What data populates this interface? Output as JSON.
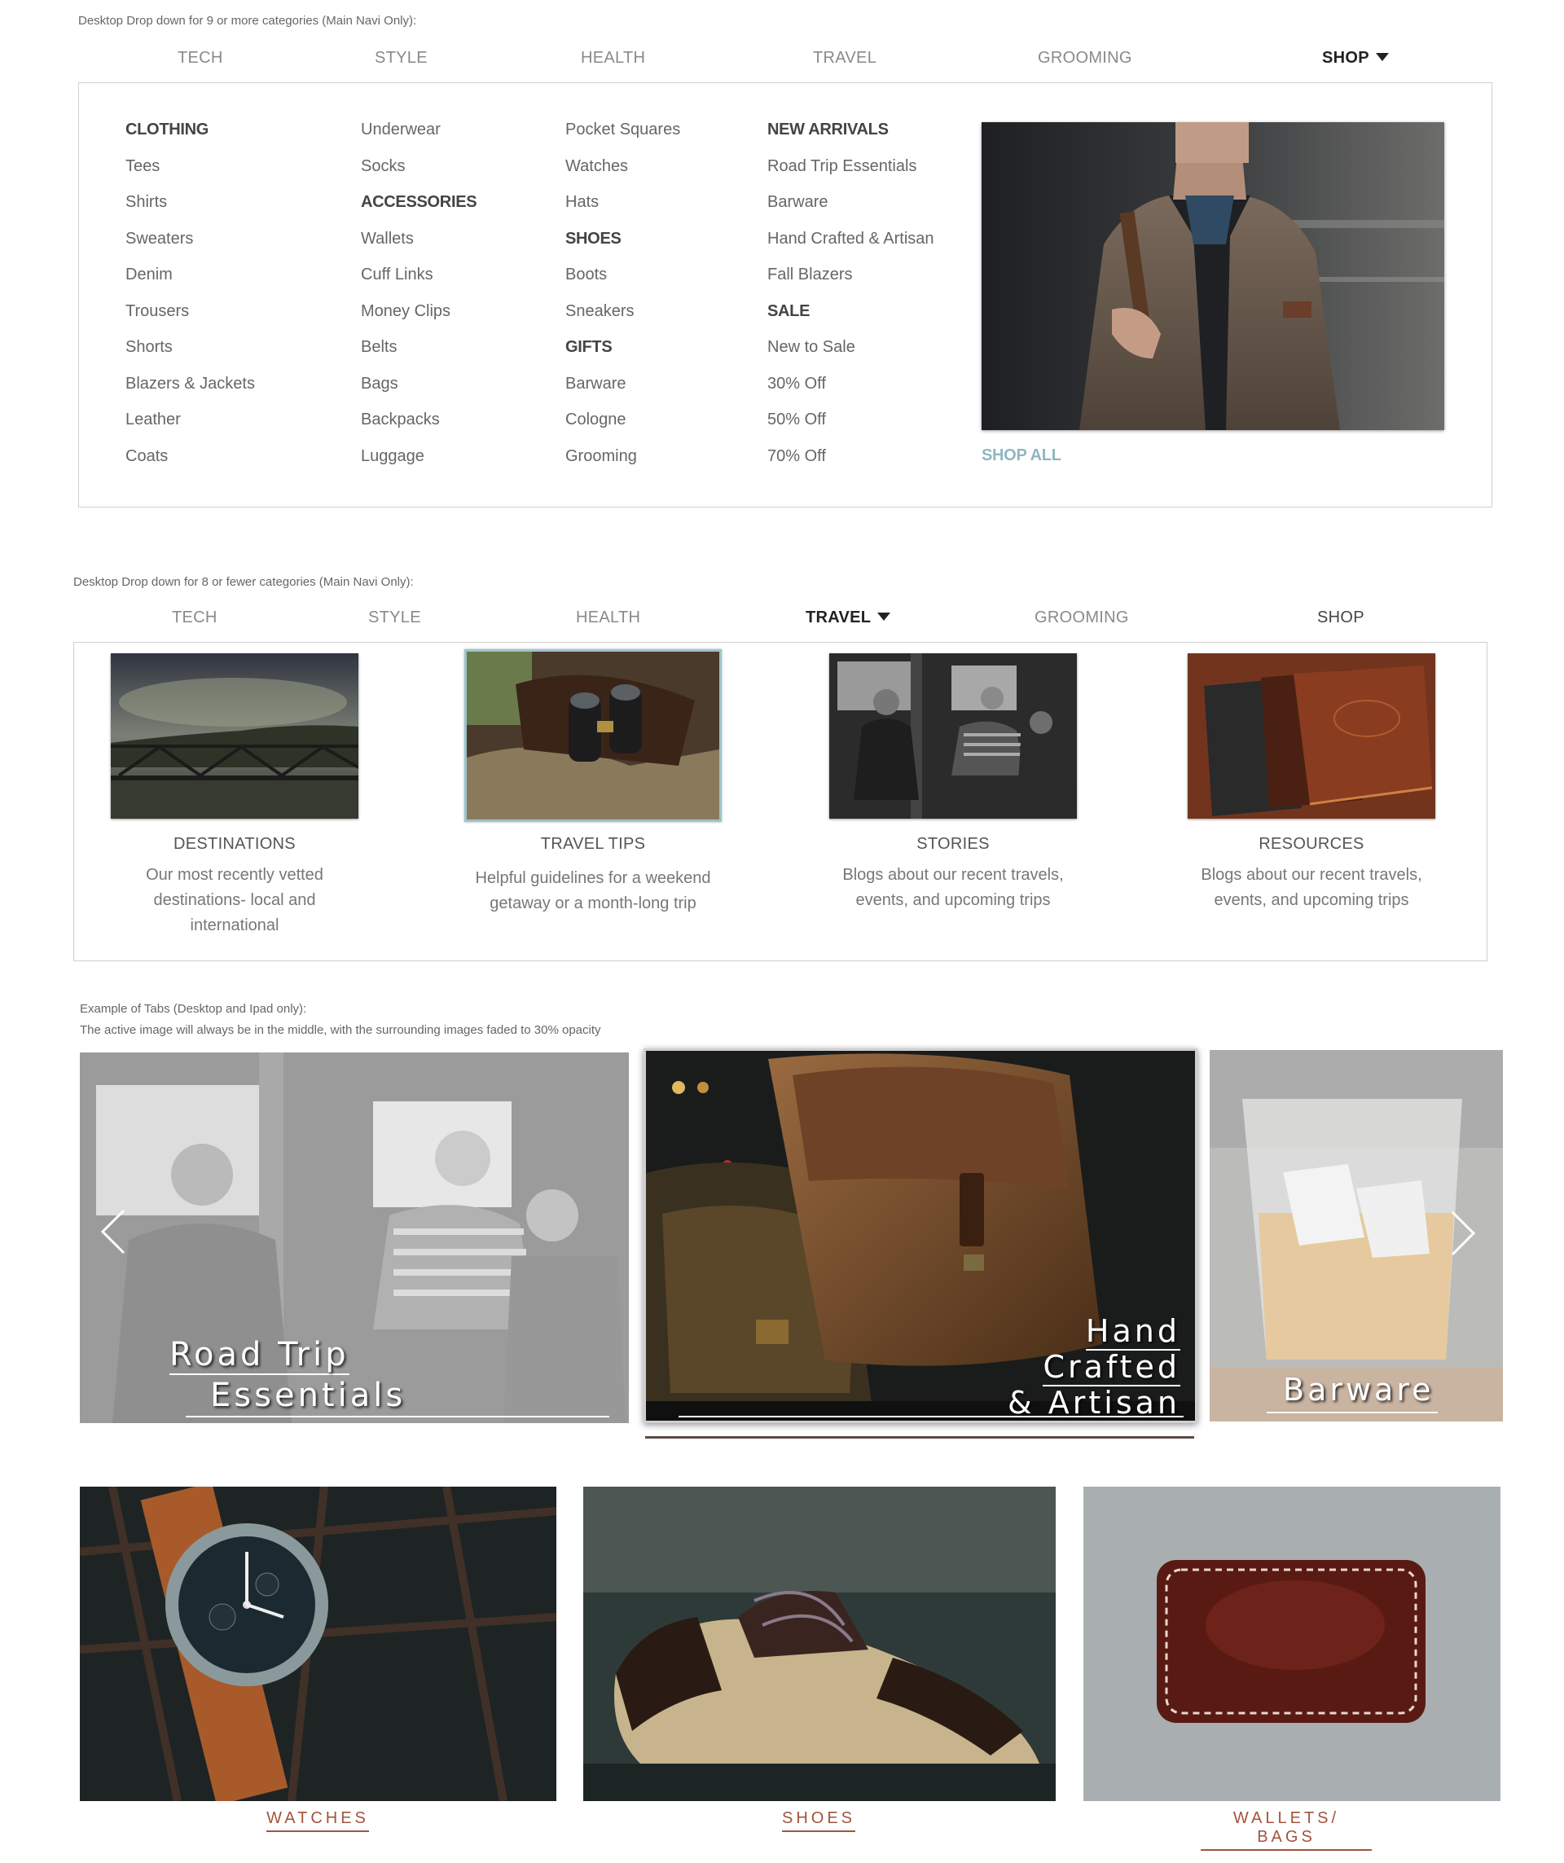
{
  "section1": {
    "note": "Desktop Drop down for 9 or more categories (Main Navi Only):",
    "nav": [
      "TECH",
      "STYLE",
      "HEALTH",
      "TRAVEL",
      "GROOMING",
      "SHOP"
    ],
    "col1": [
      "CLOTHING",
      "Tees",
      "Shirts",
      "Sweaters",
      "Denim",
      "Trousers",
      "Shorts",
      "Blazers & Jackets",
      "Leather",
      "Coats"
    ],
    "col2": [
      "Underwear",
      "Socks",
      "ACCESSORIES",
      "Wallets",
      "Cuff Links",
      "Money Clips",
      "Belts",
      "Bags",
      "Backpacks",
      "Luggage"
    ],
    "col3": [
      "Pocket Squares",
      "Watches",
      "Hats",
      "SHOES",
      "Boots",
      "Sneakers",
      "GIFTS",
      "Barware",
      "Cologne",
      "Grooming"
    ],
    "col4": [
      "NEW ARRIVALS",
      "Road Trip Essentials",
      "Barware",
      "Hand Crafted & Artisan",
      "Fall Blazers",
      "SALE",
      "New to Sale",
      "30% Off",
      "50% Off",
      "70% Off"
    ],
    "shop_all": "SHOP ALL"
  },
  "section2": {
    "note": "Desktop Drop down for 8 or fewer categories (Main Navi Only):",
    "nav": [
      "TECH",
      "STYLE",
      "HEALTH",
      "TRAVEL",
      "GROOMING",
      "SHOP"
    ],
    "cards": [
      {
        "title": "DESTINATIONS",
        "desc_lines": [
          "Our most recently vetted",
          "destinations- local and",
          "international"
        ]
      },
      {
        "title": "TRAVEL TIPS",
        "desc_lines": [
          "Helpful guidelines for a weekend",
          "getaway or a month-long trip"
        ]
      },
      {
        "title": "STORIES",
        "desc_lines": [
          "Blogs about our recent travels,",
          "events, and upcoming trips"
        ]
      },
      {
        "title": "RESOURCES",
        "desc_lines": [
          "Blogs about our recent travels,",
          "events, and upcoming trips"
        ]
      }
    ]
  },
  "section3": {
    "note1": "Example of Tabs (Desktop and Ipad only):",
    "note2": "The active image will always be in the middle, with the surrounding images faded to 30% opacity",
    "tabs": {
      "left_l1": "Road Trip",
      "left_l2": "Essentials",
      "mid_l1": "Hand",
      "mid_l2": "Crafted",
      "mid_l3": "& Artisan",
      "right": "Barware"
    },
    "inactive_opacity": "30%"
  },
  "section4": {
    "labels": [
      "WATCHES",
      "SHOES",
      "WALLETS/ BAGS"
    ]
  },
  "colors": {
    "accent_teal": "#8fb6c1",
    "accent_rust": "#a2543c"
  }
}
